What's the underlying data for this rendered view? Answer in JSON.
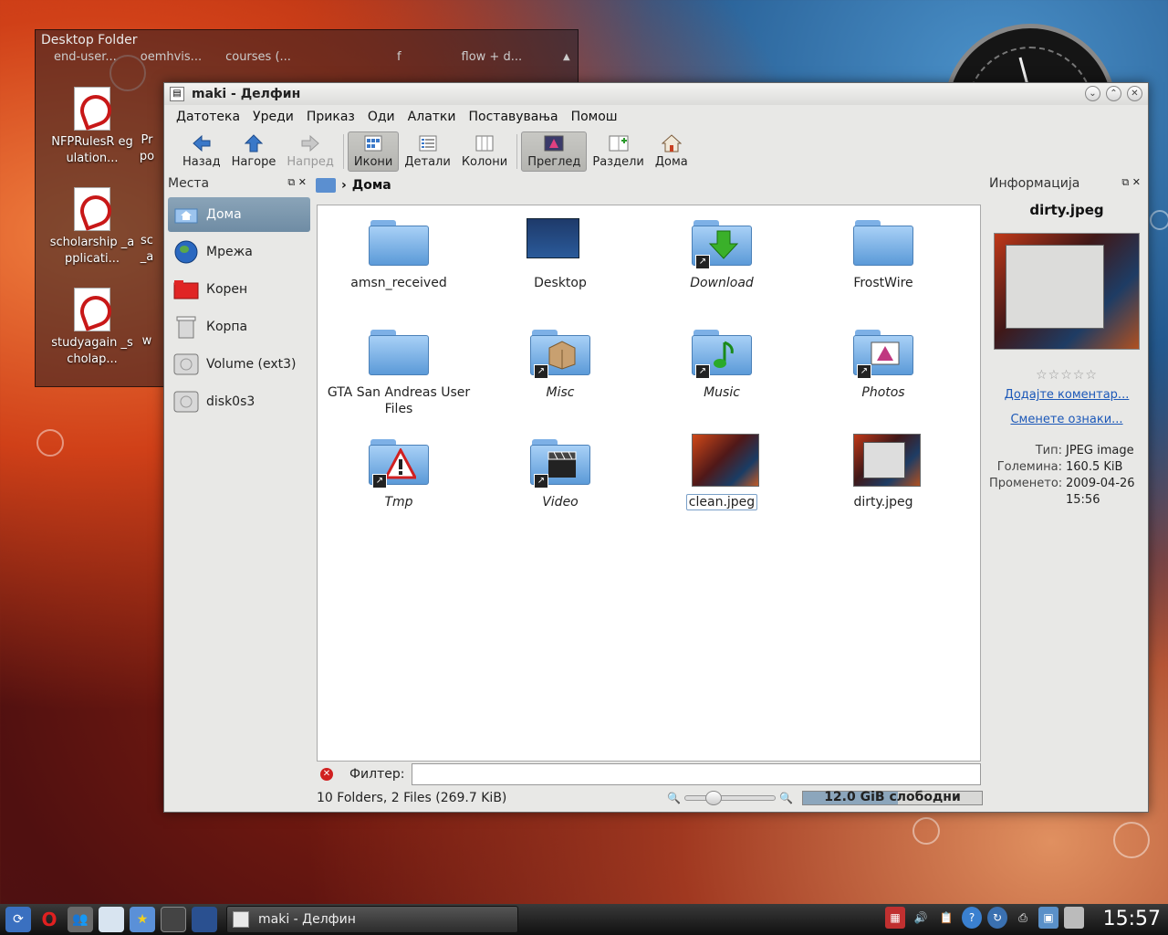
{
  "desktop_folder": {
    "title": "Desktop Folder",
    "top_row": [
      "end-user...",
      "oemhvis...",
      "courses (...",
      "f",
      "flow + d..."
    ],
    "items": [
      {
        "label": "NFPRulesR egulation...",
        "partial": "Pr po"
      },
      {
        "label": "scholarship _applicati...",
        "partial": "sc _a"
      },
      {
        "label": "studyagain _scholap...",
        "partial": "w"
      }
    ]
  },
  "window": {
    "title": "maki - Делфин"
  },
  "menu": [
    "Датотека",
    "Уреди",
    "Приказ",
    "Оди",
    "Алатки",
    "Поставувања",
    "Помош"
  ],
  "toolbar": {
    "back": "Назад",
    "up": "Нагоре",
    "forward": "Напред",
    "icons": "Икони",
    "details": "Детали",
    "columns": "Колони",
    "preview": "Преглед",
    "split": "Раздели",
    "home": "Дома"
  },
  "places": {
    "title": "Места",
    "items": [
      "Дома",
      "Мрежа",
      "Корен",
      "Корпа",
      "Volume (ext3)",
      "disk0s3"
    ]
  },
  "breadcrumb": "Дома",
  "files": [
    {
      "name": "amsn_received",
      "italic": false
    },
    {
      "name": "Desktop",
      "italic": false
    },
    {
      "name": "Download",
      "italic": true
    },
    {
      "name": "FrostWire",
      "italic": false
    },
    {
      "name": "GTA San Andreas User Files",
      "italic": false
    },
    {
      "name": "Misc",
      "italic": true
    },
    {
      "name": "Music",
      "italic": true
    },
    {
      "name": "Photos",
      "italic": true
    },
    {
      "name": "Tmp",
      "italic": true
    },
    {
      "name": "Video",
      "italic": true
    },
    {
      "name": "clean.jpeg",
      "italic": false
    },
    {
      "name": "dirty.jpeg",
      "italic": false
    }
  ],
  "filter": {
    "label": "Филтер:",
    "value": ""
  },
  "status": {
    "text": "10 Folders, 2 Files (269.7 KiB)",
    "free_space": "12.0 GiB слободни",
    "used_fraction": 0.53
  },
  "info": {
    "title": "Информација",
    "filename": "dirty.jpeg",
    "stars": "☆☆☆☆☆",
    "add_comment": "Додајте коментар...",
    "change_tags": "Сменете ознаки...",
    "props": [
      {
        "key": "Тип:",
        "value": "JPEG image"
      },
      {
        "key": "Големина:",
        "value": "160.5 KiB"
      },
      {
        "key": "Променето:",
        "value": "2009-04-26 15:56"
      }
    ]
  },
  "taskbar": {
    "task_label": "maki - Делфин",
    "time": "15:57"
  }
}
